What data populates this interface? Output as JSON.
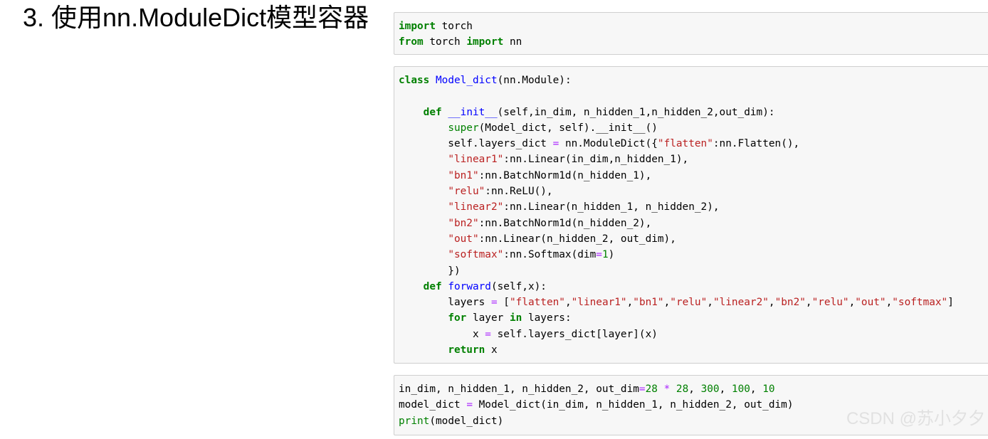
{
  "heading": "3. 使用nn.ModuleDict模型容器",
  "cells": [
    {
      "lines": [
        [
          [
            "kw",
            "import"
          ],
          [
            "t",
            " torch"
          ]
        ],
        [
          [
            "kw",
            "from"
          ],
          [
            "t",
            " torch "
          ],
          [
            "kw",
            "import"
          ],
          [
            "t",
            " nn"
          ]
        ]
      ]
    },
    {
      "lines": [
        [
          [
            "kw",
            "class"
          ],
          [
            "t",
            " "
          ],
          [
            "nm",
            "Model_dict"
          ],
          [
            "t",
            "(nn.Module):"
          ]
        ],
        [
          [
            "t",
            ""
          ]
        ],
        [
          [
            "t",
            "    "
          ],
          [
            "kw",
            "def"
          ],
          [
            "t",
            " "
          ],
          [
            "nm",
            "__init__"
          ],
          [
            "t",
            "(self,in_dim, n_hidden_1,n_hidden_2,out_dim):"
          ]
        ],
        [
          [
            "t",
            "        "
          ],
          [
            "bi",
            "super"
          ],
          [
            "t",
            "(Model_dict, self).__init__()"
          ]
        ],
        [
          [
            "t",
            "        self.layers_dict "
          ],
          [
            "op",
            "="
          ],
          [
            "t",
            " nn.ModuleDict({"
          ],
          [
            "str",
            "\"flatten\""
          ],
          [
            "t",
            ":nn.Flatten(),"
          ]
        ],
        [
          [
            "t",
            "        "
          ],
          [
            "str",
            "\"linear1\""
          ],
          [
            "t",
            ":nn.Linear(in_dim,n_hidden_1),"
          ]
        ],
        [
          [
            "t",
            "        "
          ],
          [
            "str",
            "\"bn1\""
          ],
          [
            "t",
            ":nn.BatchNorm1d(n_hidden_1),"
          ]
        ],
        [
          [
            "t",
            "        "
          ],
          [
            "str",
            "\"relu\""
          ],
          [
            "t",
            ":nn.ReLU(),"
          ]
        ],
        [
          [
            "t",
            "        "
          ],
          [
            "str",
            "\"linear2\""
          ],
          [
            "t",
            ":nn.Linear(n_hidden_1, n_hidden_2),"
          ]
        ],
        [
          [
            "t",
            "        "
          ],
          [
            "str",
            "\"bn2\""
          ],
          [
            "t",
            ":nn.BatchNorm1d(n_hidden_2),"
          ]
        ],
        [
          [
            "t",
            "        "
          ],
          [
            "str",
            "\"out\""
          ],
          [
            "t",
            ":nn.Linear(n_hidden_2, out_dim),"
          ]
        ],
        [
          [
            "t",
            "        "
          ],
          [
            "str",
            "\"softmax\""
          ],
          [
            "t",
            ":nn.Softmax(dim"
          ],
          [
            "op",
            "="
          ],
          [
            "num",
            "1"
          ],
          [
            "t",
            ")"
          ]
        ],
        [
          [
            "t",
            "        })"
          ]
        ],
        [
          [
            "t",
            "    "
          ],
          [
            "kw",
            "def"
          ],
          [
            "t",
            " "
          ],
          [
            "nm",
            "forward"
          ],
          [
            "t",
            "(self,x):"
          ]
        ],
        [
          [
            "t",
            "        layers "
          ],
          [
            "op",
            "="
          ],
          [
            "t",
            " ["
          ],
          [
            "str",
            "\"flatten\""
          ],
          [
            "t",
            ","
          ],
          [
            "str",
            "\"linear1\""
          ],
          [
            "t",
            ","
          ],
          [
            "str",
            "\"bn1\""
          ],
          [
            "t",
            ","
          ],
          [
            "str",
            "\"relu\""
          ],
          [
            "t",
            ","
          ],
          [
            "str",
            "\"linear2\""
          ],
          [
            "t",
            ","
          ],
          [
            "str",
            "\"bn2\""
          ],
          [
            "t",
            ","
          ],
          [
            "str",
            "\"relu\""
          ],
          [
            "t",
            ","
          ],
          [
            "str",
            "\"out\""
          ],
          [
            "t",
            ","
          ],
          [
            "str",
            "\"softmax\""
          ],
          [
            "t",
            "]"
          ]
        ],
        [
          [
            "t",
            "        "
          ],
          [
            "kw",
            "for"
          ],
          [
            "t",
            " layer "
          ],
          [
            "kw",
            "in"
          ],
          [
            "t",
            " layers:"
          ]
        ],
        [
          [
            "t",
            "            x "
          ],
          [
            "op",
            "="
          ],
          [
            "t",
            " self.layers_dict[layer](x)"
          ]
        ],
        [
          [
            "t",
            "        "
          ],
          [
            "kw",
            "return"
          ],
          [
            "t",
            " x"
          ]
        ]
      ]
    },
    {
      "lines": [
        [
          [
            "t",
            "in_dim, n_hidden_1, n_hidden_2, out_dim"
          ],
          [
            "op",
            "="
          ],
          [
            "num",
            "28"
          ],
          [
            "t",
            " "
          ],
          [
            "op",
            "*"
          ],
          [
            "t",
            " "
          ],
          [
            "num",
            "28"
          ],
          [
            "t",
            ", "
          ],
          [
            "num",
            "300"
          ],
          [
            "t",
            ", "
          ],
          [
            "num",
            "100"
          ],
          [
            "t",
            ", "
          ],
          [
            "num",
            "10"
          ]
        ],
        [
          [
            "t",
            "model_dict "
          ],
          [
            "op",
            "="
          ],
          [
            "t",
            " Model_dict(in_dim, n_hidden_1, n_hidden_2, out_dim)"
          ]
        ],
        [
          [
            "bi",
            "print"
          ],
          [
            "t",
            "(model_dict)"
          ]
        ]
      ]
    }
  ],
  "watermark": "CSDN @苏小夕夕"
}
